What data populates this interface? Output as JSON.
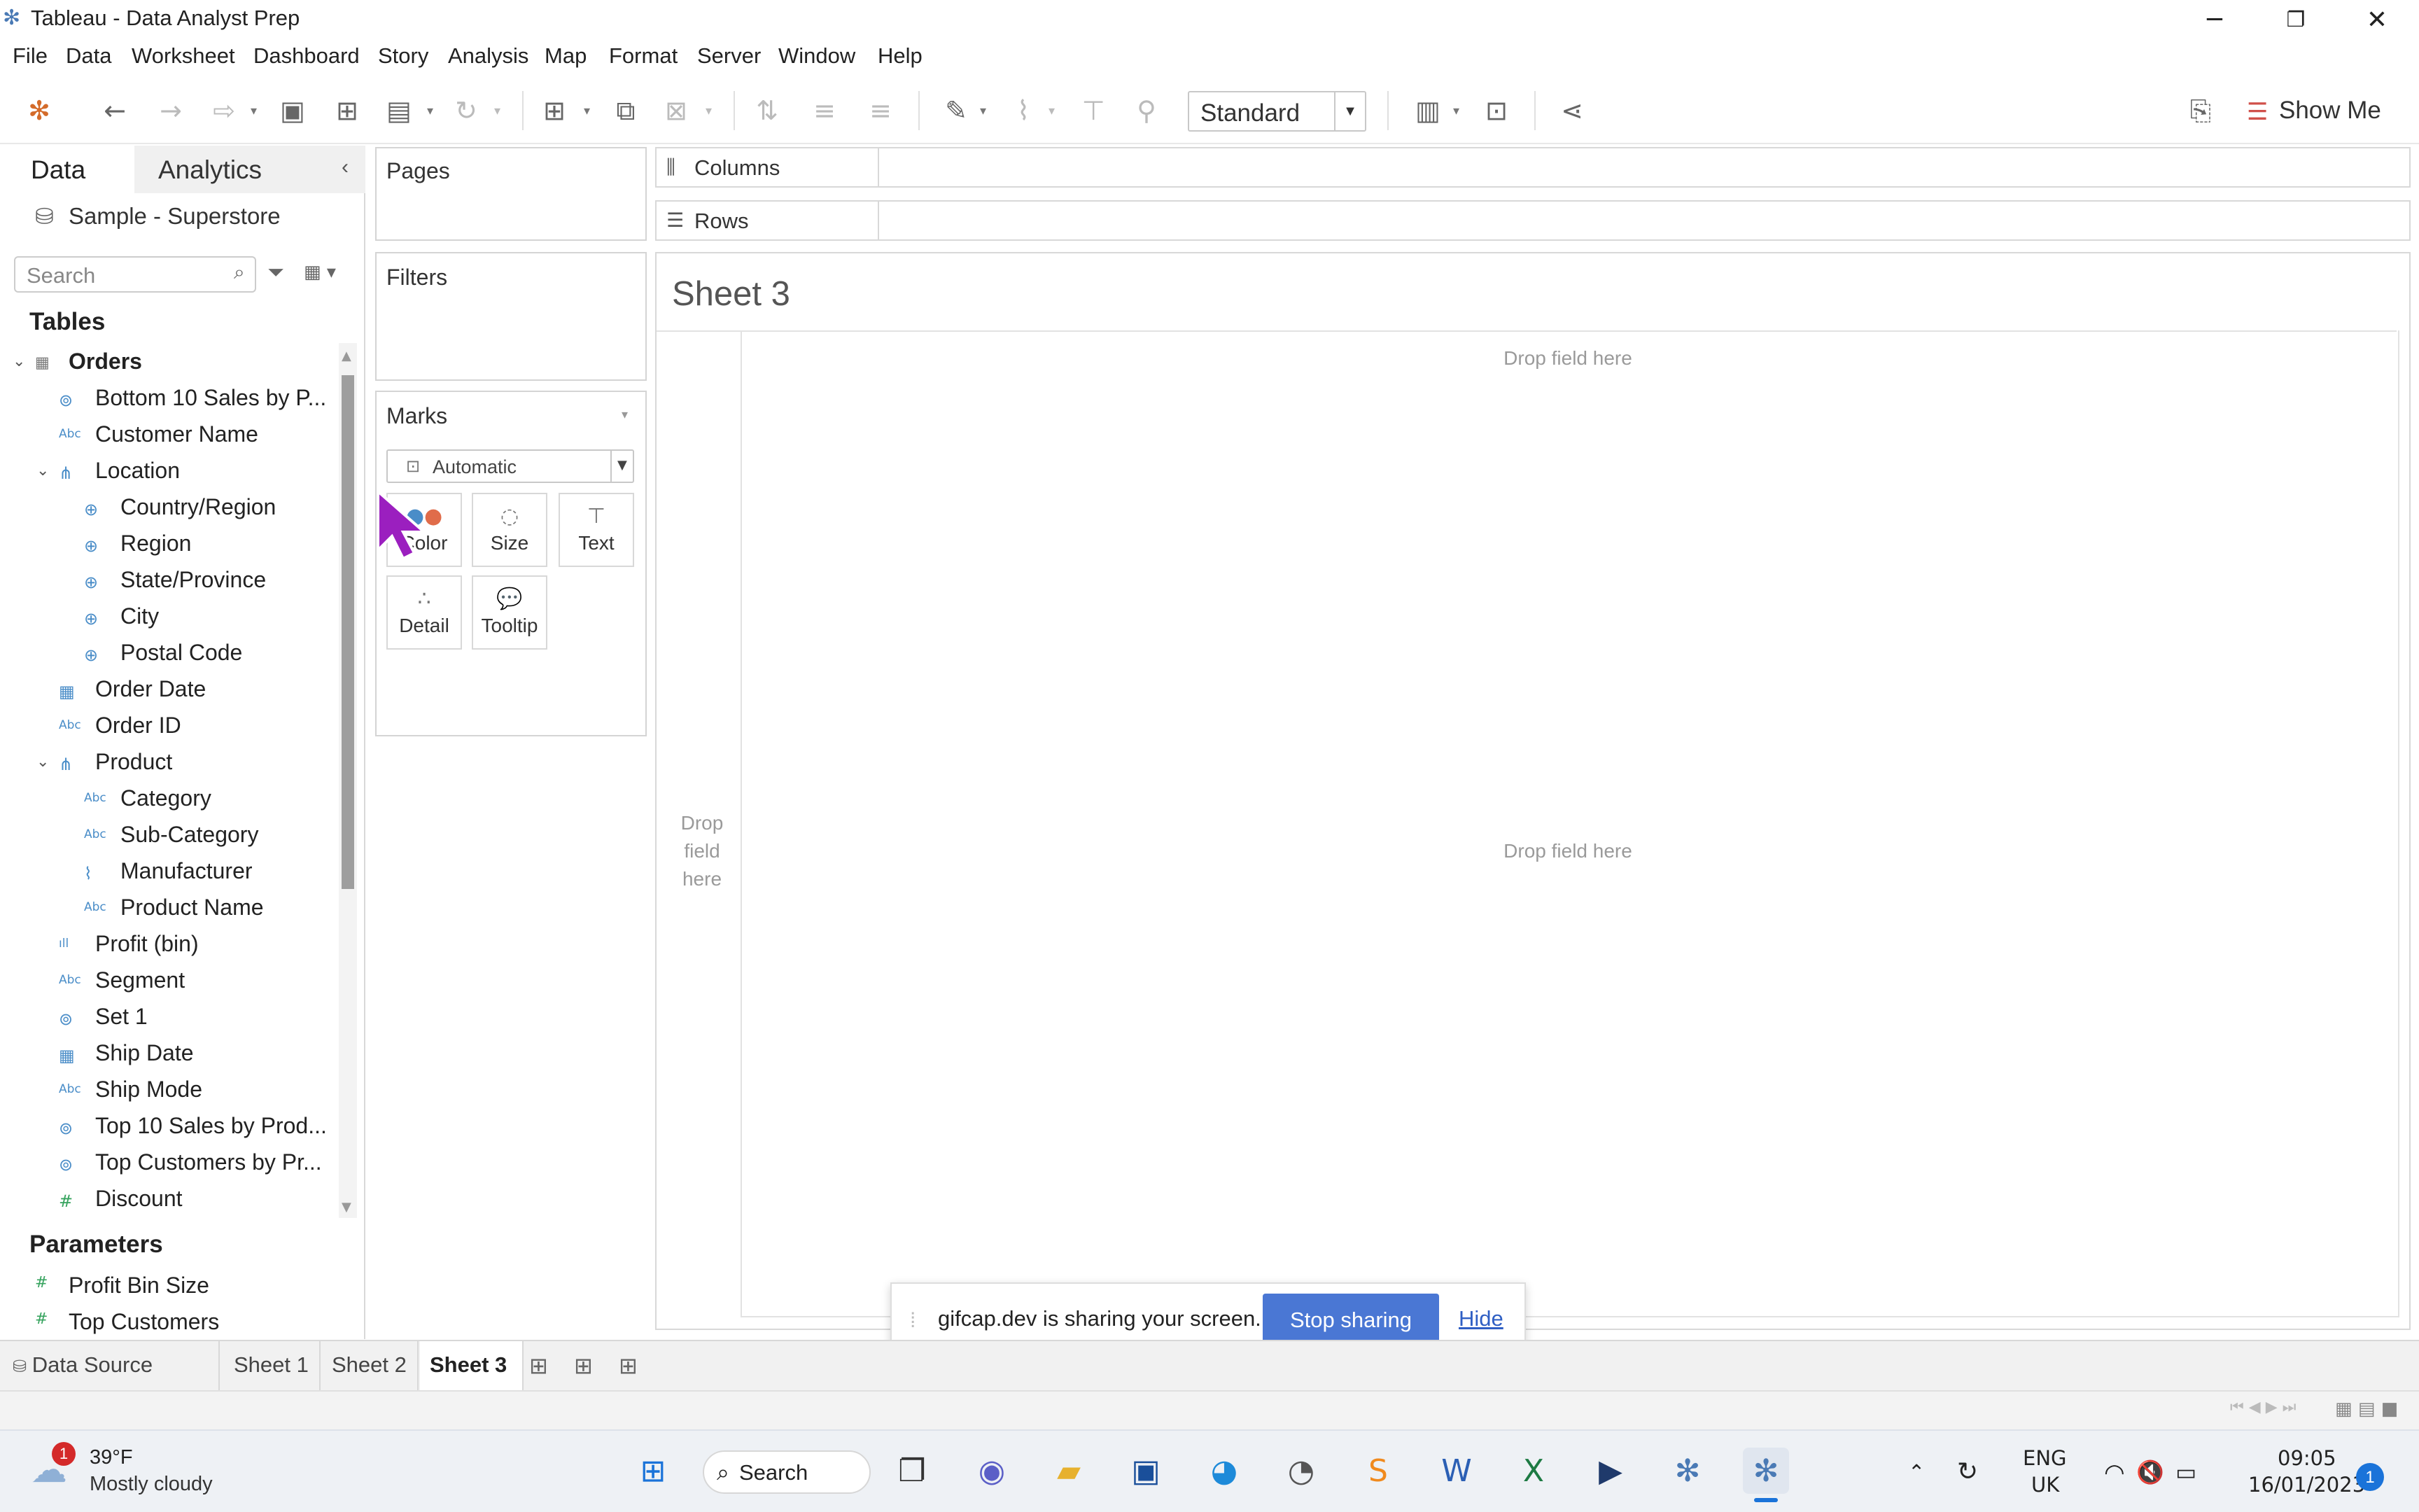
{
  "window": {
    "title": "Tableau - Data Analyst Prep"
  },
  "menu": [
    "File",
    "Data",
    "Worksheet",
    "Dashboard",
    "Story",
    "Analysis",
    "Map",
    "Format",
    "Server",
    "Window",
    "Help"
  ],
  "toolbar": {
    "fit_value": "Standard",
    "show_me_label": "Show Me"
  },
  "data_pane": {
    "tabs": {
      "data": "Data",
      "analytics": "Analytics"
    },
    "datasource": "Sample - Superstore",
    "search_placeholder": "Search",
    "tables_heading": "Tables",
    "table_name": "Orders",
    "fields": [
      {
        "label": "Bottom 10 Sales by P...",
        "icon": "set-icon"
      },
      {
        "label": "Customer Name",
        "icon": "abc-icon"
      },
      {
        "label": "Location",
        "icon": "hierarchy-icon"
      },
      {
        "label": "Country/Region",
        "icon": "globe-icon"
      },
      {
        "label": "Region",
        "icon": "globe-icon"
      },
      {
        "label": "State/Province",
        "icon": "globe-icon"
      },
      {
        "label": "City",
        "icon": "globe-icon"
      },
      {
        "label": "Postal Code",
        "icon": "globe-icon"
      },
      {
        "label": "Order Date",
        "icon": "calendar-icon"
      },
      {
        "label": "Order ID",
        "icon": "abc-icon"
      },
      {
        "label": "Product",
        "icon": "hierarchy-icon"
      },
      {
        "label": "Category",
        "icon": "abc-icon"
      },
      {
        "label": "Sub-Category",
        "icon": "abc-icon"
      },
      {
        "label": "Manufacturer",
        "icon": "paperclip-icon"
      },
      {
        "label": "Product Name",
        "icon": "abc-icon"
      },
      {
        "label": "Profit (bin)",
        "icon": "bin-icon"
      },
      {
        "label": "Segment",
        "icon": "abc-icon"
      },
      {
        "label": "Set 1",
        "icon": "set-icon"
      },
      {
        "label": "Ship Date",
        "icon": "calendar-icon"
      },
      {
        "label": "Ship Mode",
        "icon": "abc-icon"
      },
      {
        "label": "Top 10 Sales by Prod...",
        "icon": "set-icon"
      },
      {
        "label": "Top Customers by Pr...",
        "icon": "set-icon"
      },
      {
        "label": "Discount",
        "icon": "number-icon"
      }
    ],
    "parameters_heading": "Parameters",
    "parameters": [
      {
        "label": "Profit Bin Size",
        "icon": "number-icon"
      },
      {
        "label": "Top Customers",
        "icon": "number-icon"
      }
    ]
  },
  "cards": {
    "pages": "Pages",
    "filters": "Filters",
    "marks": "Marks",
    "marks_type": "Automatic"
  },
  "mark_buttons": {
    "color": "Color",
    "size": "Size",
    "text": "Text",
    "detail": "Detail",
    "tooltip": "Tooltip"
  },
  "shelves": {
    "columns": "Columns",
    "rows": "Rows"
  },
  "view": {
    "sheet_title": "Sheet 3",
    "drop_top": "Drop field here",
    "drop_center": "Drop field here",
    "drop_left": "Drop field here"
  },
  "share_banner": {
    "message": "gifcap.dev is sharing your screen.",
    "stop": "Stop sharing",
    "hide": "Hide"
  },
  "sheet_tabs": {
    "datasource": "Data Source",
    "sheets": [
      "Sheet 1",
      "Sheet 2",
      "Sheet 3"
    ],
    "active": "Sheet 3"
  },
  "taskbar": {
    "weather_temp": "39°F",
    "weather_desc": "Mostly cloudy",
    "weather_badge": "1",
    "search_label": "Search",
    "lang": "ENG",
    "region": "UK",
    "time": "09:05",
    "date": "16/01/2023",
    "notification_count": "1"
  }
}
